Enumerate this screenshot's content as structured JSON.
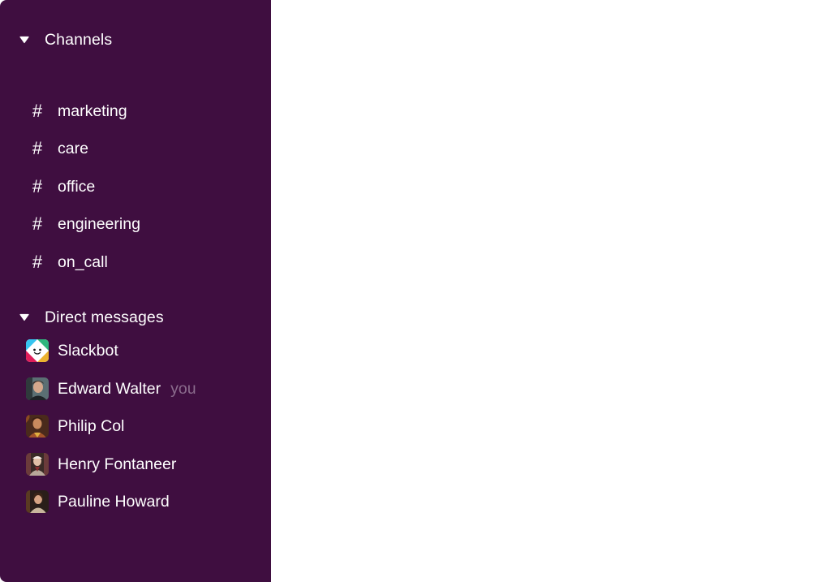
{
  "sidebar": {
    "channels_header": "Channels",
    "channels": [
      {
        "label": "marketing"
      },
      {
        "label": "care"
      },
      {
        "label": "office"
      },
      {
        "label": "engineering"
      },
      {
        "label": "on_call"
      }
    ],
    "dm_header": "Direct messages",
    "direct_messages": [
      {
        "label": "Slackbot",
        "avatar": "slackbot-icon"
      },
      {
        "label": "Edward Walter",
        "tag": "you",
        "avatar": "avatar"
      },
      {
        "label": "Philip Col",
        "avatar": "avatar"
      },
      {
        "label": "Henry Fontaneer",
        "avatar": "avatar"
      },
      {
        "label": "Pauline Howard",
        "avatar": "avatar"
      }
    ]
  },
  "colors": {
    "sidebar_bg": "#3f0e40",
    "text": "#ffffff",
    "muted": "#8a6b8c"
  }
}
